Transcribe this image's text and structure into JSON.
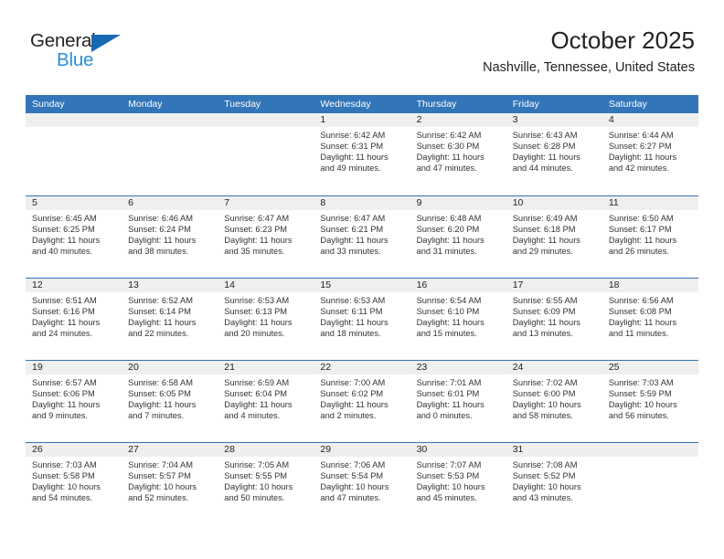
{
  "logo": {
    "text_primary": "General",
    "text_secondary": "Blue",
    "triangle_color": "#1668b3",
    "secondary_color": "#2a8fd4"
  },
  "header": {
    "title": "October 2025",
    "subtitle": "Nashville, Tennessee, United States"
  },
  "theme": {
    "header_blue": "#3275b8",
    "day_band_gray": "#efefef",
    "text_color": "#333333"
  },
  "weekdays": [
    "Sunday",
    "Monday",
    "Tuesday",
    "Wednesday",
    "Thursday",
    "Friday",
    "Saturday"
  ],
  "weeks": [
    [
      {
        "day": "",
        "lines": []
      },
      {
        "day": "",
        "lines": []
      },
      {
        "day": "",
        "lines": []
      },
      {
        "day": "1",
        "lines": [
          "Sunrise: 6:42 AM",
          "Sunset: 6:31 PM",
          "Daylight: 11 hours",
          "and 49 minutes."
        ]
      },
      {
        "day": "2",
        "lines": [
          "Sunrise: 6:42 AM",
          "Sunset: 6:30 PM",
          "Daylight: 11 hours",
          "and 47 minutes."
        ]
      },
      {
        "day": "3",
        "lines": [
          "Sunrise: 6:43 AM",
          "Sunset: 6:28 PM",
          "Daylight: 11 hours",
          "and 44 minutes."
        ]
      },
      {
        "day": "4",
        "lines": [
          "Sunrise: 6:44 AM",
          "Sunset: 6:27 PM",
          "Daylight: 11 hours",
          "and 42 minutes."
        ]
      }
    ],
    [
      {
        "day": "5",
        "lines": [
          "Sunrise: 6:45 AM",
          "Sunset: 6:25 PM",
          "Daylight: 11 hours",
          "and 40 minutes."
        ]
      },
      {
        "day": "6",
        "lines": [
          "Sunrise: 6:46 AM",
          "Sunset: 6:24 PM",
          "Daylight: 11 hours",
          "and 38 minutes."
        ]
      },
      {
        "day": "7",
        "lines": [
          "Sunrise: 6:47 AM",
          "Sunset: 6:23 PM",
          "Daylight: 11 hours",
          "and 35 minutes."
        ]
      },
      {
        "day": "8",
        "lines": [
          "Sunrise: 6:47 AM",
          "Sunset: 6:21 PM",
          "Daylight: 11 hours",
          "and 33 minutes."
        ]
      },
      {
        "day": "9",
        "lines": [
          "Sunrise: 6:48 AM",
          "Sunset: 6:20 PM",
          "Daylight: 11 hours",
          "and 31 minutes."
        ]
      },
      {
        "day": "10",
        "lines": [
          "Sunrise: 6:49 AM",
          "Sunset: 6:18 PM",
          "Daylight: 11 hours",
          "and 29 minutes."
        ]
      },
      {
        "day": "11",
        "lines": [
          "Sunrise: 6:50 AM",
          "Sunset: 6:17 PM",
          "Daylight: 11 hours",
          "and 26 minutes."
        ]
      }
    ],
    [
      {
        "day": "12",
        "lines": [
          "Sunrise: 6:51 AM",
          "Sunset: 6:16 PM",
          "Daylight: 11 hours",
          "and 24 minutes."
        ]
      },
      {
        "day": "13",
        "lines": [
          "Sunrise: 6:52 AM",
          "Sunset: 6:14 PM",
          "Daylight: 11 hours",
          "and 22 minutes."
        ]
      },
      {
        "day": "14",
        "lines": [
          "Sunrise: 6:53 AM",
          "Sunset: 6:13 PM",
          "Daylight: 11 hours",
          "and 20 minutes."
        ]
      },
      {
        "day": "15",
        "lines": [
          "Sunrise: 6:53 AM",
          "Sunset: 6:11 PM",
          "Daylight: 11 hours",
          "and 18 minutes."
        ]
      },
      {
        "day": "16",
        "lines": [
          "Sunrise: 6:54 AM",
          "Sunset: 6:10 PM",
          "Daylight: 11 hours",
          "and 15 minutes."
        ]
      },
      {
        "day": "17",
        "lines": [
          "Sunrise: 6:55 AM",
          "Sunset: 6:09 PM",
          "Daylight: 11 hours",
          "and 13 minutes."
        ]
      },
      {
        "day": "18",
        "lines": [
          "Sunrise: 6:56 AM",
          "Sunset: 6:08 PM",
          "Daylight: 11 hours",
          "and 11 minutes."
        ]
      }
    ],
    [
      {
        "day": "19",
        "lines": [
          "Sunrise: 6:57 AM",
          "Sunset: 6:06 PM",
          "Daylight: 11 hours",
          "and 9 minutes."
        ]
      },
      {
        "day": "20",
        "lines": [
          "Sunrise: 6:58 AM",
          "Sunset: 6:05 PM",
          "Daylight: 11 hours",
          "and 7 minutes."
        ]
      },
      {
        "day": "21",
        "lines": [
          "Sunrise: 6:59 AM",
          "Sunset: 6:04 PM",
          "Daylight: 11 hours",
          "and 4 minutes."
        ]
      },
      {
        "day": "22",
        "lines": [
          "Sunrise: 7:00 AM",
          "Sunset: 6:02 PM",
          "Daylight: 11 hours",
          "and 2 minutes."
        ]
      },
      {
        "day": "23",
        "lines": [
          "Sunrise: 7:01 AM",
          "Sunset: 6:01 PM",
          "Daylight: 11 hours",
          "and 0 minutes."
        ]
      },
      {
        "day": "24",
        "lines": [
          "Sunrise: 7:02 AM",
          "Sunset: 6:00 PM",
          "Daylight: 10 hours",
          "and 58 minutes."
        ]
      },
      {
        "day": "25",
        "lines": [
          "Sunrise: 7:03 AM",
          "Sunset: 5:59 PM",
          "Daylight: 10 hours",
          "and 56 minutes."
        ]
      }
    ],
    [
      {
        "day": "26",
        "lines": [
          "Sunrise: 7:03 AM",
          "Sunset: 5:58 PM",
          "Daylight: 10 hours",
          "and 54 minutes."
        ]
      },
      {
        "day": "27",
        "lines": [
          "Sunrise: 7:04 AM",
          "Sunset: 5:57 PM",
          "Daylight: 10 hours",
          "and 52 minutes."
        ]
      },
      {
        "day": "28",
        "lines": [
          "Sunrise: 7:05 AM",
          "Sunset: 5:55 PM",
          "Daylight: 10 hours",
          "and 50 minutes."
        ]
      },
      {
        "day": "29",
        "lines": [
          "Sunrise: 7:06 AM",
          "Sunset: 5:54 PM",
          "Daylight: 10 hours",
          "and 47 minutes."
        ]
      },
      {
        "day": "30",
        "lines": [
          "Sunrise: 7:07 AM",
          "Sunset: 5:53 PM",
          "Daylight: 10 hours",
          "and 45 minutes."
        ]
      },
      {
        "day": "31",
        "lines": [
          "Sunrise: 7:08 AM",
          "Sunset: 5:52 PM",
          "Daylight: 10 hours",
          "and 43 minutes."
        ]
      },
      {
        "day": "",
        "lines": []
      }
    ]
  ]
}
